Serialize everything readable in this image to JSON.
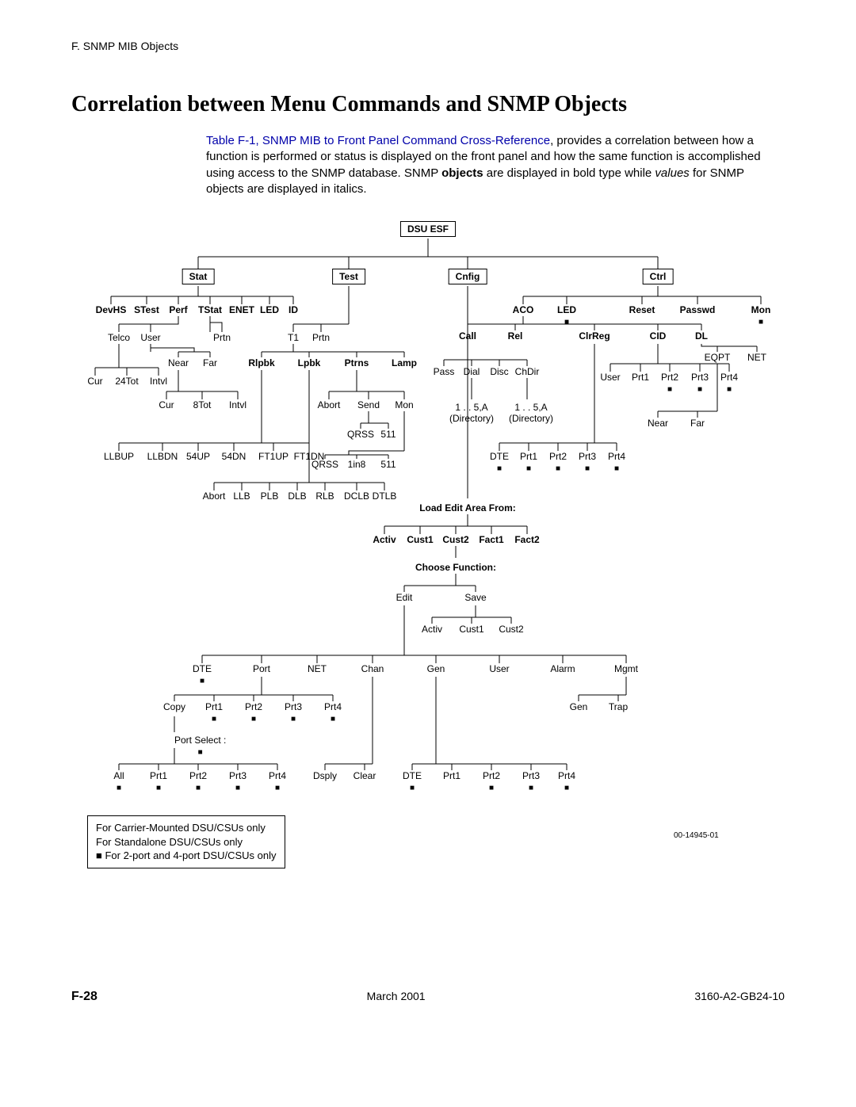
{
  "running_head": "F. SNMP MIB Objects",
  "title": "Correlation between Menu Commands and SNMP Objects",
  "intro": {
    "link_text": "Table F-1, SNMP MIB to Front Panel Command Cross-Reference",
    "rest1": ", provides a correlation between how a function is performed or status is displayed on the front panel and how the same function is accomplished using access to the SNMP database. SNMP ",
    "bold": "objects",
    "rest2": " are displayed in bold type while ",
    "ital": "values",
    "rest3": " for SNMP objects are displayed in italics."
  },
  "nodes": {
    "root": "DSU ESF",
    "stat": "Stat",
    "test": "Test",
    "cnfig": "Cnfig",
    "ctrl": "Ctrl",
    "devhs": "DevHS",
    "stest": "STest",
    "perf": "Perf",
    "tstat": "TStat",
    "enet": "ENET",
    "led": "LED",
    "id": "ID",
    "telco": "Telco",
    "user": "User",
    "prtn1": "Prtn",
    "t1": "T1",
    "prtn2": "Prtn",
    "cur1": "Cur",
    "t24": "24Tot",
    "intvl1": "Intvl",
    "near": "Near",
    "far": "Far",
    "cur2": "Cur",
    "t8": "8Tot",
    "intvl2": "Intvl",
    "rlpbk": "Rlpbk",
    "lpbk": "Lpbk",
    "ptrns": "Ptrns",
    "lamp": "Lamp",
    "llbup": "LLBUP",
    "llbdn": "LLBDN",
    "u54": "54UP",
    "d54": "54DN",
    "ft1u": "FT1UP",
    "ft1d": "FT1DN",
    "abort1": "Abort",
    "llb": "LLB",
    "plb": "PLB",
    "dlb": "DLB",
    "rlb": "RLB",
    "dclb": "DCLB",
    "dtlb": "DTLB",
    "abort2": "Abort",
    "send": "Send",
    "mon": "Mon",
    "qrss1": "QRSS",
    "n511a": "511",
    "qrss2": "QRSS",
    "in8": "1in8",
    "n511b": "511",
    "aco": "ACO",
    "ledc": "LED",
    "reset": "Reset",
    "passwd": "Passwd",
    "monc": "Mon",
    "call": "Call",
    "rel": "Rel",
    "clrreg": "ClrReg",
    "cid": "CID",
    "dl": "DL",
    "pass": "Pass",
    "dial": "Dial",
    "disc": "Disc",
    "chdir": "ChDir",
    "dir1": "1 . . 5,A",
    "dir1s": "(Directory)",
    "dir2": "1 . . 5,A",
    "dir2s": "(Directory)",
    "eqpt": "EQPT",
    "net": "NET",
    "userc": "User",
    "prt1c": "Prt1",
    "prt2c": "Prt2",
    "prt3c": "Prt3",
    "prt4c": "Prt4",
    "nearc": "Near",
    "farc": "Far",
    "dtec": "DTE",
    "prt1d": "Prt1",
    "prt2d": "Prt2",
    "prt3d": "Prt3",
    "prt4d": "Prt4",
    "load": "Load Edit Area From:",
    "activ": "Activ",
    "cust1": "Cust1",
    "cust2": "Cust2",
    "fact1": "Fact1",
    "fact2": "Fact2",
    "choose": "Choose Function:",
    "edit": "Edit",
    "save": "Save",
    "activ2": "Activ",
    "cust1b": "Cust1",
    "cust2b": "Cust2",
    "dte2": "DTE",
    "port": "Port",
    "net2": "NET",
    "chan": "Chan",
    "gen": "Gen",
    "user2": "User",
    "alarm": "Alarm",
    "mgmt": "Mgmt",
    "copy": "Copy",
    "cp1": "Prt1",
    "cp2": "Prt2",
    "cp3": "Prt3",
    "cp4": "Prt4",
    "gen2": "Gen",
    "trap": "Trap",
    "portsel": "Port Select :",
    "all": "All",
    "ap1": "Prt1",
    "ap2": "Prt2",
    "ap3": "Prt3",
    "ap4": "Prt4",
    "dsply": "Dsply",
    "clear": "Clear",
    "dte3": "DTE",
    "dp1": "Prt1",
    "dp2": "Prt2",
    "dp3": "Prt3",
    "dp4": "Prt4"
  },
  "legend": {
    "l1": "For Carrier-Mounted DSU/CSUs only",
    "l2": "For Standalone DSU/CSUs only",
    "l3": "■ For 2-port and 4-port DSU/CSUs only"
  },
  "fig_no": "00-14945-01",
  "footer": {
    "page": "F-28",
    "date": "March 2001",
    "doc": "3160-A2-GB24-10"
  }
}
